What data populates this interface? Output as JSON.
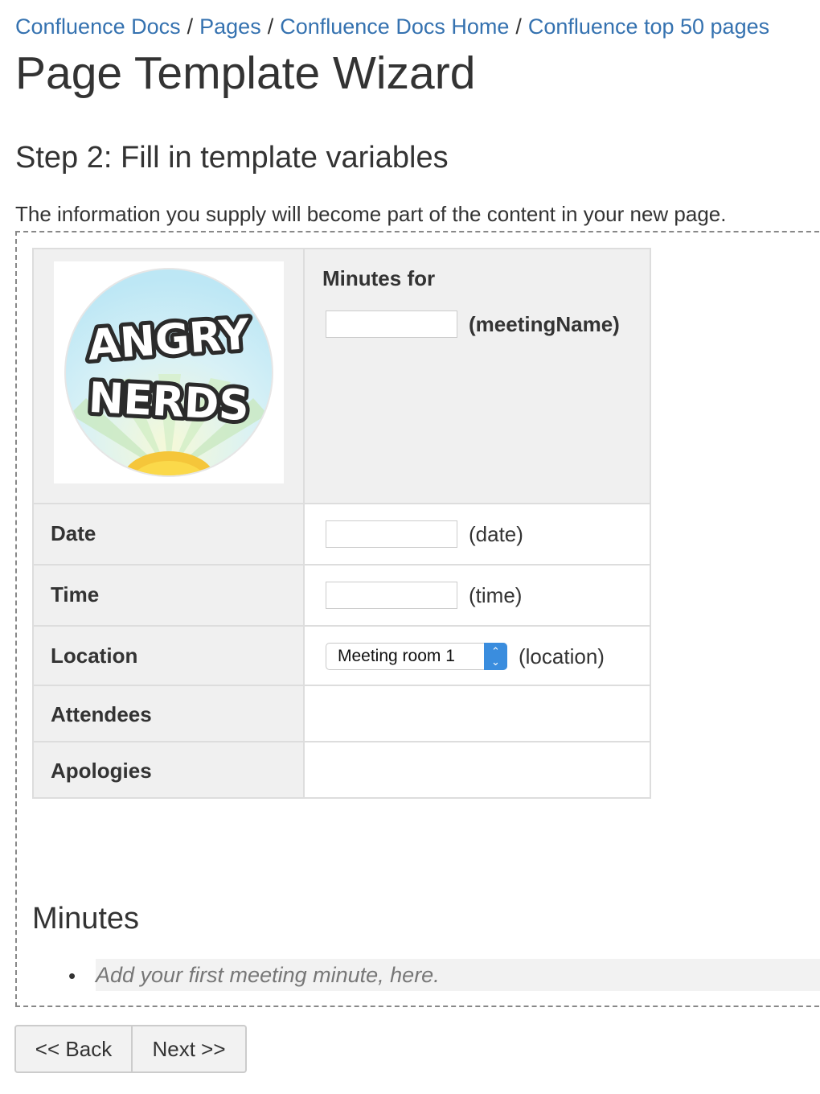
{
  "breadcrumbs": [
    "Confluence Docs",
    "Pages",
    "Confluence Docs Home",
    "Confluence top 50 pages"
  ],
  "breadcrumb_separator": "/",
  "page_title": "Page Template Wizard",
  "step_heading": "Step 2: Fill in template variables",
  "intro_text": "The information you supply will become part of the content in your new page.",
  "logo": {
    "line1": "ANGRY",
    "line2": "NERDS"
  },
  "template": {
    "minutes_for_label": "Minutes for",
    "meeting_name_var": "(meetingName)",
    "meeting_name_value": "",
    "rows": {
      "date": {
        "label": "Date",
        "var": "(date)",
        "value": ""
      },
      "time": {
        "label": "Time",
        "var": "(time)",
        "value": ""
      },
      "location": {
        "label": "Location",
        "var": "(location)",
        "selected": "Meeting room 1"
      },
      "attendees": {
        "label": "Attendees"
      },
      "apologies": {
        "label": "Apologies"
      }
    },
    "minutes_heading": "Minutes",
    "minute_placeholder": "Add your first meeting minute, here."
  },
  "buttons": {
    "back": "<< Back",
    "next": "Next >>"
  },
  "colors": {
    "link": "#3572b0",
    "table_header_bg": "#f0f0f0",
    "select_accent": "#3a8dde"
  },
  "icons": {
    "select_arrow": "chevron-up-down-icon"
  }
}
